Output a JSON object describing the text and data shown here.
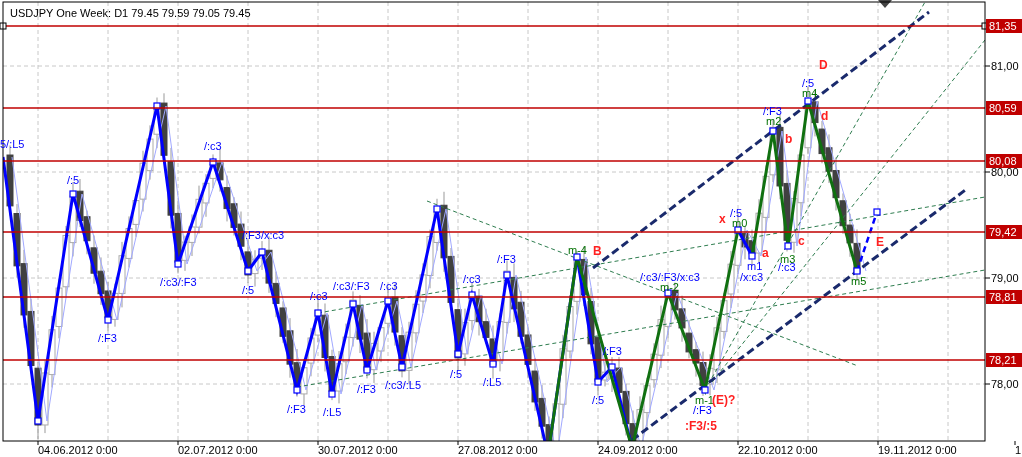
{
  "chart_title": "USDJPY One  Week: D1  79.45  79.59  79.05  79.45",
  "levels": [
    {
      "label": "81,35",
      "selected": true
    },
    {
      "label": "80,59",
      "selected": false
    },
    {
      "label": "80,08",
      "selected": false
    },
    {
      "label": "79,42",
      "selected": false
    },
    {
      "label": "78,81",
      "selected": false
    },
    {
      "label": "78,21",
      "selected": false
    }
  ],
  "price_ticks": [
    "81,00",
    "80,00",
    "79,00",
    "78,00"
  ],
  "dates": [
    "04.06.2012 0:00",
    "02.07.2012 0:00",
    "30.07.2012 0:00",
    "27.08.2012 0:00",
    "24.09.2012 0:00",
    "22.10.2012 0:00",
    "19.11.2012 0:00",
    "1"
  ],
  "annotations": [
    {
      "text": "5/:L5",
      "kind": "wave"
    },
    {
      "text": "/:5",
      "kind": "wave"
    },
    {
      "text": "/:c3",
      "kind": "wave"
    },
    {
      "text": "/:F3/x:c3",
      "kind": "wave"
    },
    {
      "text": "/:c3/:F3",
      "kind": "wave"
    },
    {
      "text": "/:5",
      "kind": "wave"
    },
    {
      "text": "/:F3",
      "kind": "wave"
    },
    {
      "text": "/:c3",
      "kind": "wave"
    },
    {
      "text": "/:c3/:F3",
      "kind": "wave"
    },
    {
      "text": "/:c3",
      "kind": "wave"
    },
    {
      "text": "/:F3",
      "kind": "wave"
    },
    {
      "text": "/:L5",
      "kind": "wave"
    },
    {
      "text": "/:F3",
      "kind": "wave"
    },
    {
      "text": "/:c3/:L5",
      "kind": "wave"
    },
    {
      "text": "/:c3",
      "kind": "wave"
    },
    {
      "text": "/:5",
      "kind": "wave"
    },
    {
      "text": "/:L5",
      "kind": "wave"
    },
    {
      "text": "/:F3",
      "kind": "wave"
    },
    {
      "text": "/:F3",
      "kind": "wave"
    },
    {
      "text": "/:5",
      "kind": "wave"
    },
    {
      "text": "/:c3/:F3/x:c3",
      "kind": "wave"
    },
    {
      "text": "/x:c3",
      "kind": "wave"
    },
    {
      "text": "/:c3",
      "kind": "wave"
    },
    {
      "text": "/:F3",
      "kind": "wave"
    },
    {
      "text": "/:5",
      "kind": "wave"
    },
    {
      "text": "/:F3",
      "kind": "wave"
    },
    {
      "text": "/:5",
      "kind": "wave"
    },
    {
      "text": "m1",
      "kind": "wave"
    },
    {
      "text": "m-4",
      "kind": "marker"
    },
    {
      "text": "m-2",
      "kind": "marker"
    },
    {
      "text": "m3",
      "kind": "marker"
    },
    {
      "text": "m5",
      "kind": "marker"
    },
    {
      "text": "m-1",
      "kind": "marker"
    },
    {
      "text": "m0",
      "kind": "marker"
    },
    {
      "text": "m2",
      "kind": "marker"
    },
    {
      "text": "m4",
      "kind": "marker"
    },
    {
      "text": "B",
      "kind": "point"
    },
    {
      "text": "a",
      "kind": "point"
    },
    {
      "text": "c",
      "kind": "point"
    },
    {
      "text": "E",
      "kind": "point"
    },
    {
      "text": "(E)?",
      "kind": "point"
    },
    {
      "text": ":F3/:5",
      "kind": "point"
    },
    {
      "text": "D",
      "kind": "point"
    },
    {
      "text": "b",
      "kind": "point"
    },
    {
      "text": "d",
      "kind": "point"
    },
    {
      "text": "x",
      "kind": "point"
    }
  ]
}
